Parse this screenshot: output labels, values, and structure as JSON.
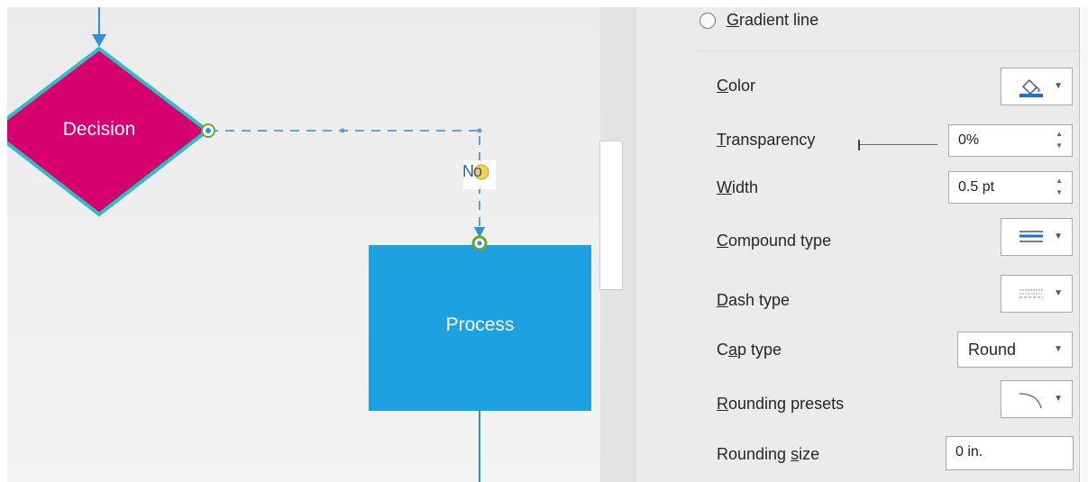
{
  "diagram": {
    "decision_label": "Decision",
    "process_label": "Process",
    "connector_label": "No",
    "colors": {
      "decision_fill": "#d6006f",
      "decision_border": "#2bbfc4",
      "process_fill": "#1ea1e0",
      "connector": "#2f8fd8",
      "handle_green": "#6aa82d",
      "handle_yellow": "#f7d04d"
    }
  },
  "format_panel": {
    "gradient_line": {
      "label_first": "G",
      "label_rest": "radient line",
      "selected": false
    },
    "color": {
      "label_first": "C",
      "label_rest": "olor",
      "swatch_color": "#1e6fd0"
    },
    "transparency": {
      "label_first": "T",
      "label_rest": "ransparency",
      "value": "0%",
      "slider_percent": 0
    },
    "width": {
      "label_first": "W",
      "label_rest": "idth",
      "value": "0.5 pt"
    },
    "compound_type": {
      "label_first": "C",
      "label_rest": "ompound type"
    },
    "dash_type": {
      "label_first": "D",
      "label_rest": "ash type"
    },
    "cap_type": {
      "label_pre": "C",
      "label_first": "a",
      "label_rest": "p type",
      "value": "Round"
    },
    "rounding_presets": {
      "label_first": "R",
      "label_rest": "ounding presets"
    },
    "rounding_size": {
      "label_pre": "Rounding ",
      "label_first": "s",
      "label_rest": "ize",
      "value": "0 in."
    }
  }
}
